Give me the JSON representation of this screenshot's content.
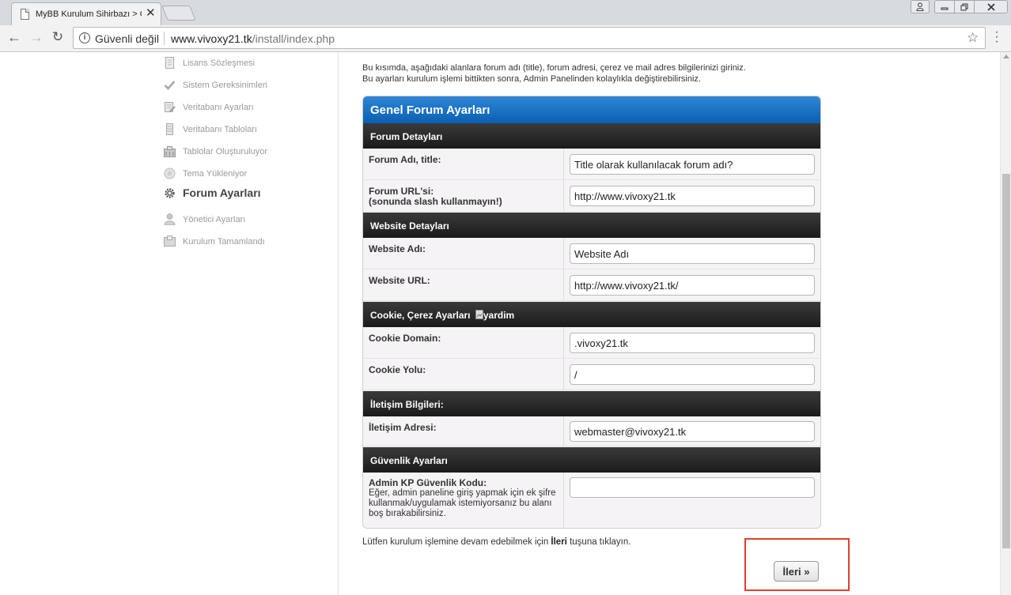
{
  "browser": {
    "tab_title": "MyBB Kurulum Sihirbazı > Genel Forum Ayarları",
    "security_label": "Güvenli değil",
    "url_host": "www.vivoxy21.tk",
    "url_path": "/install/index.php"
  },
  "sidebar": {
    "steps": [
      {
        "label": "Lisans Sözleşmesi",
        "icon": "document-icon"
      },
      {
        "label": "Sistem Gereksinimleri",
        "icon": "checkmark-icon"
      },
      {
        "label": "Veritabanı Ayarları",
        "icon": "database-edit-icon"
      },
      {
        "label": "Veritabanı Tabloları",
        "icon": "database-icon"
      },
      {
        "label": "Tablolar Oluşturuluyor",
        "icon": "building-icon"
      },
      {
        "label": "Tema Yükleniyor",
        "icon": "theme-icon"
      },
      {
        "label": "Forum Ayarları",
        "icon": "gear-icon",
        "active": true
      },
      {
        "label": "Yönetici Ayarları",
        "icon": "user-icon"
      },
      {
        "label": "Kurulum Tamamlandı",
        "icon": "finish-icon"
      }
    ]
  },
  "intro": {
    "line1": "Bu kısımda, aşağıdaki alanlara forum adı (title), forum adresi, çerez ve mail adres bilgilerinizi giriniz.",
    "line2": "Bu ayarları kurulum işlemi bittikten sonra, Admin Panelinden kolaylıkla değiştirebilirsiniz."
  },
  "box": {
    "title": "Genel Forum Ayarları",
    "sections": {
      "forum": "Forum Detayları",
      "website": "Website Detayları",
      "cookie": "Cookie, Çerez Ayarları",
      "cookie_help_alt": "yardim",
      "contact": "İletişim Bilgileri:",
      "security": "Güvenlik Ayarları"
    },
    "fields": {
      "forum_name": {
        "label": "Forum Adı, title:",
        "value": "Title olarak kullanılacak forum adı?"
      },
      "forum_url": {
        "label": "Forum URL'si:",
        "sub": "(sonunda slash kullanmayın!)",
        "value": "http://www.vivoxy21.tk"
      },
      "website_name": {
        "label": "Website Adı:",
        "value": "Website Adı"
      },
      "website_url": {
        "label": "Website URL:",
        "value": "http://www.vivoxy21.tk/"
      },
      "cookie_domain": {
        "label": "Cookie Domain:",
        "value": ".vivoxy21.tk"
      },
      "cookie_path": {
        "label": "Cookie Yolu:",
        "value": "/"
      },
      "contact_email": {
        "label": "İletişim Adresi:",
        "value": "webmaster@vivoxy21.tk"
      },
      "acp_pin": {
        "label": "Admin KP Güvenlik Kodu:",
        "sub": "Eğer, admin paneline giriş yapmak için ek şifre kullanmak/uygulamak istemiyorsanız bu alanı boş bırakabilirsiniz.",
        "value": ""
      }
    }
  },
  "footer": {
    "continue_before": "Lütfen kurulum işlemine devam edebilmek için ",
    "continue_bold": "İleri",
    "continue_after": " tuşuna tıklayın.",
    "next_button": "İleri »"
  },
  "colors": {
    "header_blue": "#0a5fb3",
    "section_dark": "#1b1b1b",
    "highlight_red": "#e63d2e"
  }
}
